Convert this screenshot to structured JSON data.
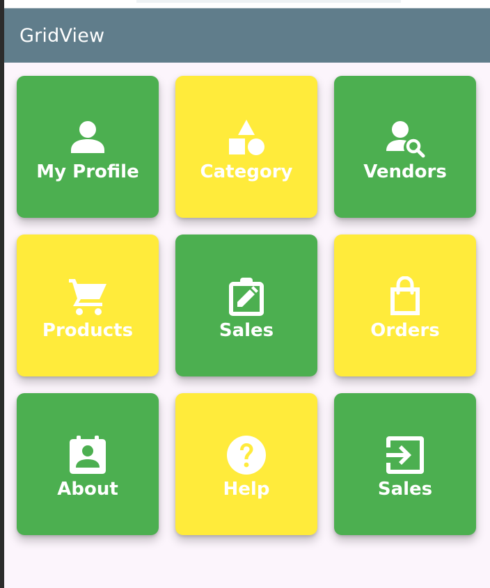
{
  "appbar": {
    "title": "GridView"
  },
  "colors": {
    "appbar": "#607d8b",
    "green_tile": "#4caf50",
    "yellow_tile": "#ffeb3b",
    "background": "#fcf5fc",
    "label": "#ffffff"
  },
  "tiles": [
    {
      "label": "My Profile",
      "icon": "person-icon",
      "color": "green"
    },
    {
      "label": "Category",
      "icon": "category-shapes-icon",
      "color": "yellow"
    },
    {
      "label": "Vendors",
      "icon": "person-search-icon",
      "color": "green"
    },
    {
      "label": "Products",
      "icon": "shopping-cart-icon",
      "color": "yellow"
    },
    {
      "label": "Sales",
      "icon": "edit-clipboard-icon",
      "color": "green"
    },
    {
      "label": "Orders",
      "icon": "shopping-bag-icon",
      "color": "yellow"
    },
    {
      "label": "About",
      "icon": "contact-page-icon",
      "color": "green"
    },
    {
      "label": "Help",
      "icon": "help-circle-icon",
      "color": "yellow"
    },
    {
      "label": "Sales",
      "icon": "login-icon",
      "color": "green"
    }
  ]
}
